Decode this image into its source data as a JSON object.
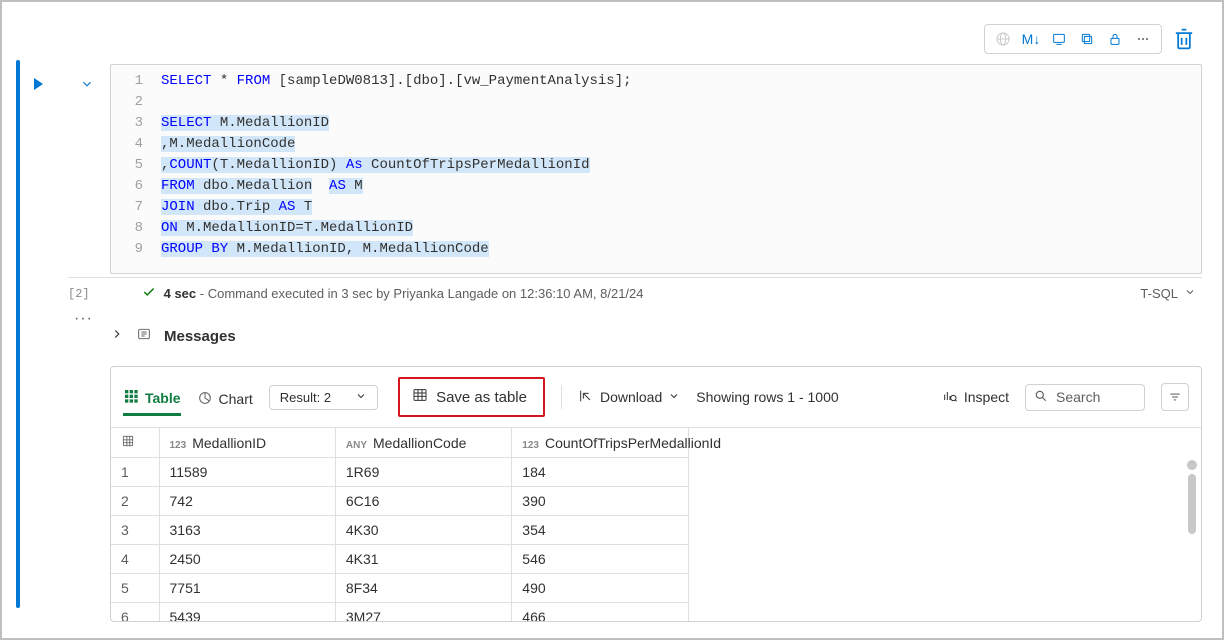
{
  "toolbar_top": {
    "markdown_label": "M↓"
  },
  "code": {
    "lines": [
      {
        "n": "1",
        "t": "SELECT * FROM [sampleDW0813].[dbo].[vw_PaymentAnalysis];"
      },
      {
        "n": "2",
        "t": ""
      },
      {
        "n": "3",
        "t": "SELECT M.MedallionID"
      },
      {
        "n": "4",
        "t": ",M.MedallionCode"
      },
      {
        "n": "5",
        "t": ",COUNT(T.MedallionID) As CountOfTripsPerMedallionId"
      },
      {
        "n": "6",
        "t": "FROM dbo.Medallion  AS M"
      },
      {
        "n": "7",
        "t": "JOIN dbo.Trip AS T"
      },
      {
        "n": "8",
        "t": "ON M.MedallionID=T.MedallionID"
      },
      {
        "n": "9",
        "t": "GROUP BY M.MedallionID, M.MedallionCode"
      }
    ]
  },
  "status": {
    "exec_index": "[2]",
    "time_bold": "4 sec",
    "detail": " - Command executed in 3 sec by Priyanka Langade on 12:36:10 AM, 8/21/24",
    "language": "T-SQL"
  },
  "messages": {
    "title": "Messages"
  },
  "results_toolbar": {
    "tab_table": "Table",
    "tab_chart": "Chart",
    "result_selector": "Result: 2",
    "save_as_table": "Save as table",
    "download": "Download",
    "rows_info": "Showing rows 1 - 1000",
    "inspect": "Inspect",
    "search_placeholder": "Search"
  },
  "grid": {
    "columns": [
      {
        "type_tag": "123",
        "name": "MedallionID"
      },
      {
        "type_tag": "ANY",
        "name": "MedallionCode"
      },
      {
        "type_tag": "123",
        "name": "CountOfTripsPerMedallionId"
      }
    ],
    "rows": [
      {
        "idx": "1",
        "c0": "11589",
        "c1": "1R69",
        "c2": "184"
      },
      {
        "idx": "2",
        "c0": "742",
        "c1": "6C16",
        "c2": "390"
      },
      {
        "idx": "3",
        "c0": "3163",
        "c1": "4K30",
        "c2": "354"
      },
      {
        "idx": "4",
        "c0": "2450",
        "c1": "4K31",
        "c2": "546"
      },
      {
        "idx": "5",
        "c0": "7751",
        "c1": "8F34",
        "c2": "490"
      },
      {
        "idx": "6",
        "c0": "5439",
        "c1": "3M27",
        "c2": "466"
      }
    ]
  }
}
